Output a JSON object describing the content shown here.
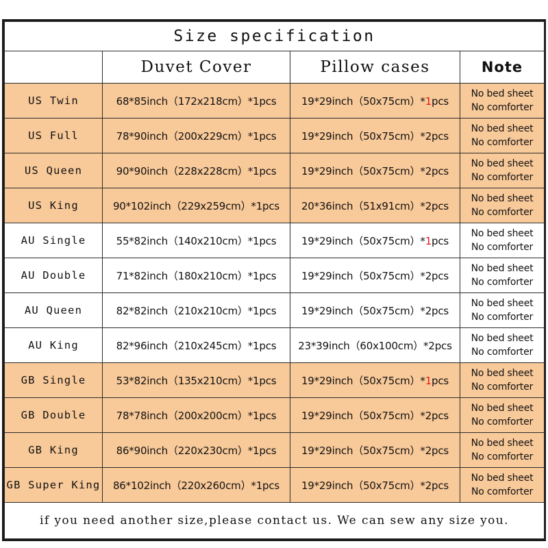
{
  "title": "Size specification",
  "headers": {
    "size": "",
    "duvet": "Duvet Cover",
    "pillow": "Pillow cases",
    "note": "Note"
  },
  "note_lines": {
    "line1": "No bed sheet",
    "line2": "No comforter"
  },
  "footer": "if you need another size,please contact us. We can sew any size you.",
  "colors": {
    "shaded_row": "#f8c999",
    "plain_row": "#ffffff",
    "border": "#2b2b2b",
    "footer_text": "#f41f1f",
    "highlight": "#e31a1a"
  },
  "rows": [
    {
      "size": "US Twin",
      "duvet": "68*85inch（172x218cm）*1pcs",
      "pillow_pre": "19*29inch（50x75cm）*",
      "pillow_qty": "1",
      "pillow_post": "pcs",
      "pillow_qty_red": true,
      "shaded": true
    },
    {
      "size": "US Full",
      "duvet": "78*90inch（200x229cm）*1pcs",
      "pillow_pre": "19*29inch（50x75cm）*",
      "pillow_qty": "2",
      "pillow_post": "pcs",
      "pillow_qty_red": false,
      "shaded": true
    },
    {
      "size": "US Queen",
      "duvet": "90*90inch（228x228cm）*1pcs",
      "pillow_pre": "19*29inch（50x75cm）*",
      "pillow_qty": "2",
      "pillow_post": "pcs",
      "pillow_qty_red": false,
      "shaded": true
    },
    {
      "size": "US King",
      "duvet": "90*102inch（229x259cm）*1pcs",
      "pillow_pre": "20*36inch（51x91cm）*",
      "pillow_qty": "2",
      "pillow_post": "pcs",
      "pillow_qty_red": false,
      "shaded": true
    },
    {
      "size": "AU Single",
      "duvet": "55*82inch（140x210cm）*1pcs",
      "pillow_pre": "19*29inch（50x75cm）*",
      "pillow_qty": "1",
      "pillow_post": "pcs",
      "pillow_qty_red": true,
      "shaded": false
    },
    {
      "size": "AU Double",
      "duvet": "71*82inch（180x210cm）*1pcs",
      "pillow_pre": "19*29inch（50x75cm）*",
      "pillow_qty": "2",
      "pillow_post": "pcs",
      "pillow_qty_red": false,
      "shaded": false
    },
    {
      "size": "AU Queen",
      "duvet": "82*82inch（210x210cm）*1pcs",
      "pillow_pre": "19*29inch（50x75cm）*",
      "pillow_qty": "2",
      "pillow_post": "pcs",
      "pillow_qty_red": false,
      "shaded": false
    },
    {
      "size": "AU King",
      "duvet": "82*96inch（210x245cm）*1pcs",
      "pillow_pre": "23*39inch（60x100cm）*",
      "pillow_qty": "2",
      "pillow_post": "pcs",
      "pillow_qty_red": false,
      "shaded": false
    },
    {
      "size": "GB Single",
      "duvet": "53*82inch（135x210cm）*1pcs",
      "pillow_pre": "19*29inch（50x75cm）*",
      "pillow_qty": "1",
      "pillow_post": "pcs",
      "pillow_qty_red": true,
      "shaded": true
    },
    {
      "size": "GB Double",
      "duvet": "78*78inch（200x200cm）*1pcs",
      "pillow_pre": "19*29inch（50x75cm）*",
      "pillow_qty": "2",
      "pillow_post": "pcs",
      "pillow_qty_red": false,
      "shaded": true
    },
    {
      "size": "GB King",
      "duvet": "86*90inch（220x230cm）*1pcs",
      "pillow_pre": "19*29inch（50x75cm）*",
      "pillow_qty": "2",
      "pillow_post": "pcs",
      "pillow_qty_red": false,
      "shaded": true
    },
    {
      "size": "GB Super King",
      "duvet": "86*102inch（220x260cm）*1pcs",
      "pillow_pre": "19*29inch（50x75cm）*",
      "pillow_qty": "2",
      "pillow_post": "pcs",
      "pillow_qty_red": false,
      "shaded": true
    }
  ]
}
